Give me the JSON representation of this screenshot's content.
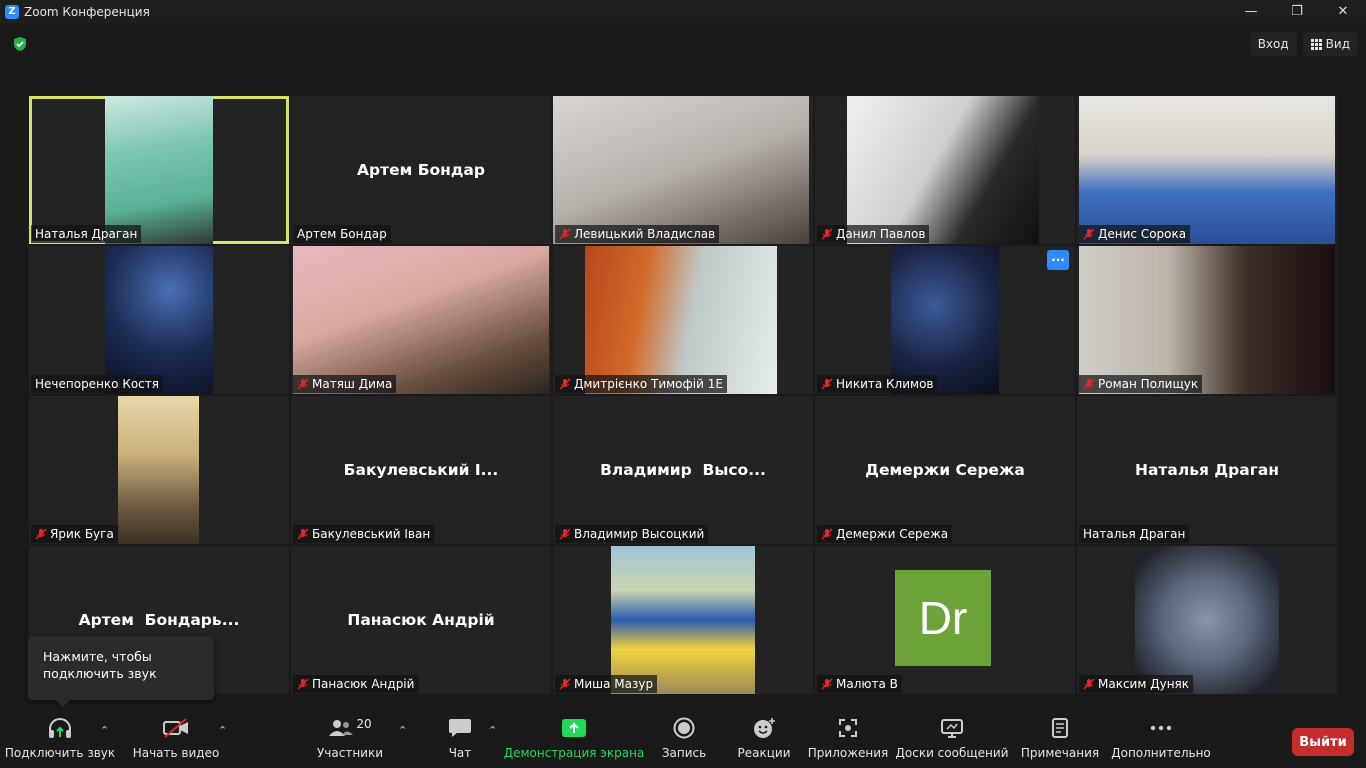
{
  "window": {
    "title": "Zoom Конференция",
    "logo_letter": "Z",
    "minimize": "—",
    "maximize": "❐",
    "close": "✕"
  },
  "top": {
    "sign_in_label": "Вход",
    "view_label": "Вид"
  },
  "tiles": [
    {
      "label": "Наталья Драган",
      "big": "",
      "muted": false
    },
    {
      "label": "Артем Бондар",
      "big": "Артем Бондар",
      "muted": false
    },
    {
      "label": "Левицький Владислав",
      "big": "",
      "muted": true
    },
    {
      "label": "Данил Павлов",
      "big": "",
      "muted": true
    },
    {
      "label": "Денис Сорока",
      "big": "",
      "muted": true
    },
    {
      "label": "Нечепоренко Костя",
      "big": "",
      "muted": false
    },
    {
      "label": "Матяш Дима",
      "big": "",
      "muted": true
    },
    {
      "label": "Дмитрієнко Тимофій 1Е",
      "big": "",
      "muted": true
    },
    {
      "label": "Никита Климов",
      "big": "",
      "muted": true
    },
    {
      "label": "Роман Полищук",
      "big": "",
      "muted": true
    },
    {
      "label": "Ярик Буга",
      "big": "",
      "muted": true
    },
    {
      "label": "Бакулевський Іван",
      "big": "Бакулевський І...",
      "muted": true
    },
    {
      "label": "Владимир Высоцкий",
      "big": "Владимир  Высо...",
      "muted": true
    },
    {
      "label": "Демержи Сережа",
      "big": "Демержи Сережа",
      "muted": true
    },
    {
      "label": "Наталья Драган",
      "big": "Наталья Драган",
      "muted": false
    },
    {
      "label": "",
      "big": "Артем  Бондарь...",
      "muted": false
    },
    {
      "label": "Панасюк Андрій",
      "big": "Панасюк Андрій",
      "muted": true
    },
    {
      "label": "Миша Мазур",
      "big": "",
      "muted": true
    },
    {
      "label": "Малюта В",
      "big": "",
      "muted": true
    },
    {
      "label": "Максим Дуняк",
      "big": "",
      "muted": true
    }
  ],
  "avatar_initials": "Dr",
  "more_button": "···",
  "tooltip": {
    "line1": "Нажмите, чтобы",
    "line2": "подключить звук"
  },
  "toolbar": {
    "join_audio": "Подключить звук",
    "start_video": "Начать видео",
    "participants": "Участники",
    "participants_count": "20",
    "chat": "Чат",
    "share_screen": "Демонстрация экрана",
    "record": "Запись",
    "reactions": "Реакции",
    "apps": "Приложения",
    "whiteboards": "Доски сообщений",
    "notes": "Примечания",
    "more": "Дополнительно",
    "leave": "Выйти"
  },
  "colors": {
    "accent": "#2d8cff",
    "active_speaker": "#d7e26b",
    "leave": "#c52c2c",
    "share_green": "#23d959",
    "mute_red": "#e02828",
    "avatar_green": "#6ea33a"
  }
}
